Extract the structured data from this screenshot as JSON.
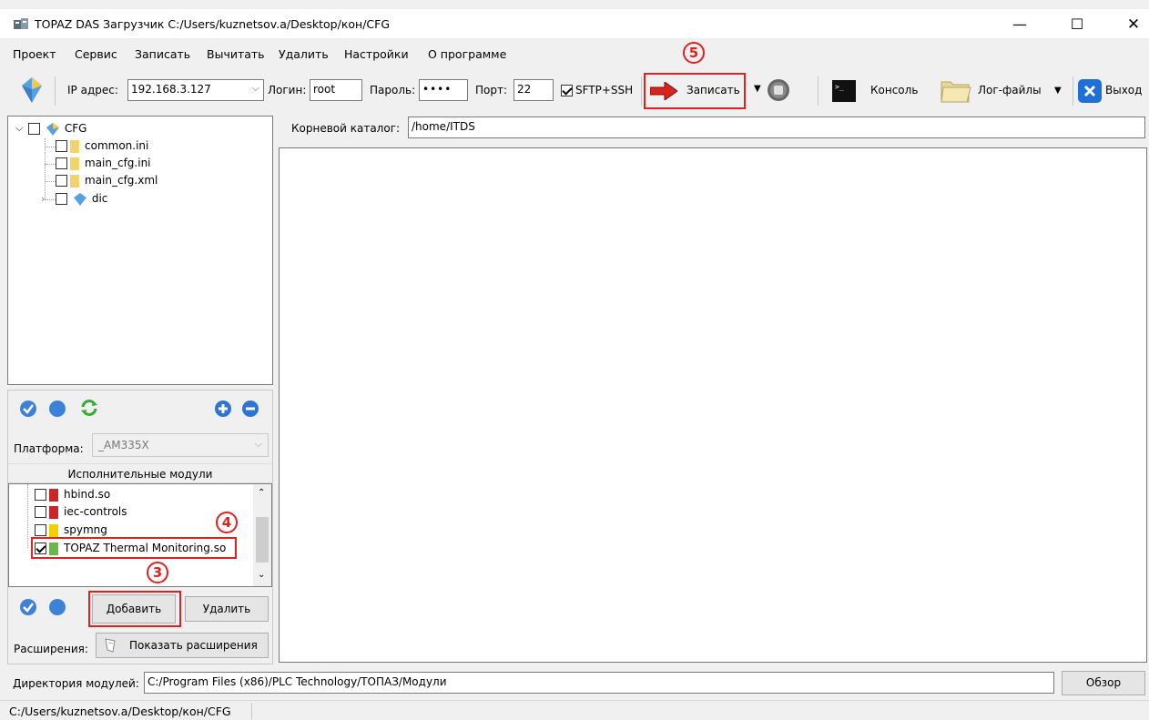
{
  "window": {
    "title": "TOPAZ DAS Загрузчик C:/Users/kuznetsov.a/Desktop/кон/CFG",
    "minimize": "—",
    "maximize": "☐",
    "close": "✕"
  },
  "menu": [
    "Проект",
    "Сервис",
    "Записать",
    "Вычитать",
    "Удалить",
    "Настройки",
    "О программе"
  ],
  "toolbar": {
    "ip_label": "IP адрес:",
    "ip_value": "192.168.3.127",
    "login_label": "Логин:",
    "login_value": "root",
    "password_label": "Пароль:",
    "password_value": "••••",
    "port_label": "Порт:",
    "port_value": "22",
    "sftp_label": "SFTP+SSH",
    "write_label": "Записать",
    "console_label": "Консоль",
    "logs_label": "Лог-файлы",
    "exit_label": "Выход"
  },
  "annotations": {
    "n3": "3",
    "n4": "4",
    "n5": "5"
  },
  "tree": {
    "root": "CFG",
    "children": [
      "common.ini",
      "main_cfg.ini",
      "main_cfg.xml",
      "dic"
    ]
  },
  "platform": {
    "label": "Платформа:",
    "value": "_AM335X"
  },
  "modules": {
    "header": "Исполнительные модули",
    "items": [
      "hbind.so",
      "iec-controls",
      "spymng",
      "TOPAZ Thermal Monitoring.so"
    ],
    "add_label": "Добавить",
    "remove_label": "Удалить"
  },
  "extensions": {
    "label": "Расширения:",
    "button": "Показать расширения"
  },
  "root_dir": {
    "label": "Корневой каталог:",
    "value": "/home/ITDS"
  },
  "module_dir": {
    "label": "Директория модулей:",
    "value": "C:/Program Files (x86)/PLC Technology/ТОПАЗ/Модули",
    "browse": "Обзор"
  },
  "statusbar": {
    "path": "C:/Users/kuznetsov.a/Desktop/кон/CFG"
  },
  "colors": {
    "accent_red": "#e0211f",
    "exit_blue": "#1e6fd6"
  }
}
